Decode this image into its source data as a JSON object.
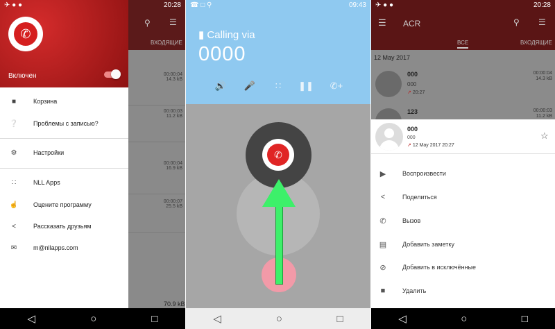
{
  "p1": {
    "status_time": "20:28",
    "toggle_label": "Включен",
    "bg_tab": "ВХОДЯЩИЕ",
    "bg_rows": [
      {
        "dur": "00:00:04",
        "size": "14.3 kB"
      },
      {
        "dur": "00:00:03",
        "size": "11.2 kB"
      },
      {
        "dur": "00:00:04",
        "size": "16.9 kB"
      },
      {
        "dur": "00:00:07",
        "size": "25.5 kB"
      }
    ],
    "bg_total": "70.9 kB",
    "menu": [
      {
        "icon": "trash-icon",
        "label": "Корзина"
      },
      {
        "icon": "help-icon",
        "label": "Проблемы с записью?"
      },
      {
        "icon": "gear-icon",
        "label": "Настройки"
      },
      {
        "icon": "apps-grid-icon",
        "label": "NLL Apps"
      },
      {
        "icon": "thumb-up-icon",
        "label": "Оцените программу"
      },
      {
        "icon": "share-icon",
        "label": "Рассказать друзьям"
      },
      {
        "icon": "mail-icon",
        "label": "m@nllapps.com"
      }
    ]
  },
  "p2": {
    "status_time": "09:43",
    "calling_via": "Calling via",
    "number": "0000"
  },
  "p3": {
    "status_time": "20:28",
    "app_title": "ACR",
    "tab_all": "ВСЕ",
    "tab_in": "ВХОДЯЩИЕ",
    "date_header": "12 May 2017",
    "rows": [
      {
        "name": "000",
        "number": "000",
        "time": "20:27",
        "dur": "00:00:04",
        "size": "14.3 kB"
      },
      {
        "name": "123",
        "number": "",
        "time": "",
        "dur": "00:00:03",
        "size": "11.2 kB"
      }
    ],
    "sheet": {
      "name": "000",
      "number": "000",
      "datetime": "12 May 2017 20:27",
      "actions": [
        {
          "icon": "play-icon",
          "label": "Воспроизвести"
        },
        {
          "icon": "share-icon",
          "label": "Поделиться"
        },
        {
          "icon": "phone-icon",
          "label": "Вызов"
        },
        {
          "icon": "note-icon",
          "label": "Добавить заметку"
        },
        {
          "icon": "block-icon",
          "label": "Добавить в исключённые"
        },
        {
          "icon": "trash-icon",
          "label": "Удалить"
        }
      ]
    }
  }
}
